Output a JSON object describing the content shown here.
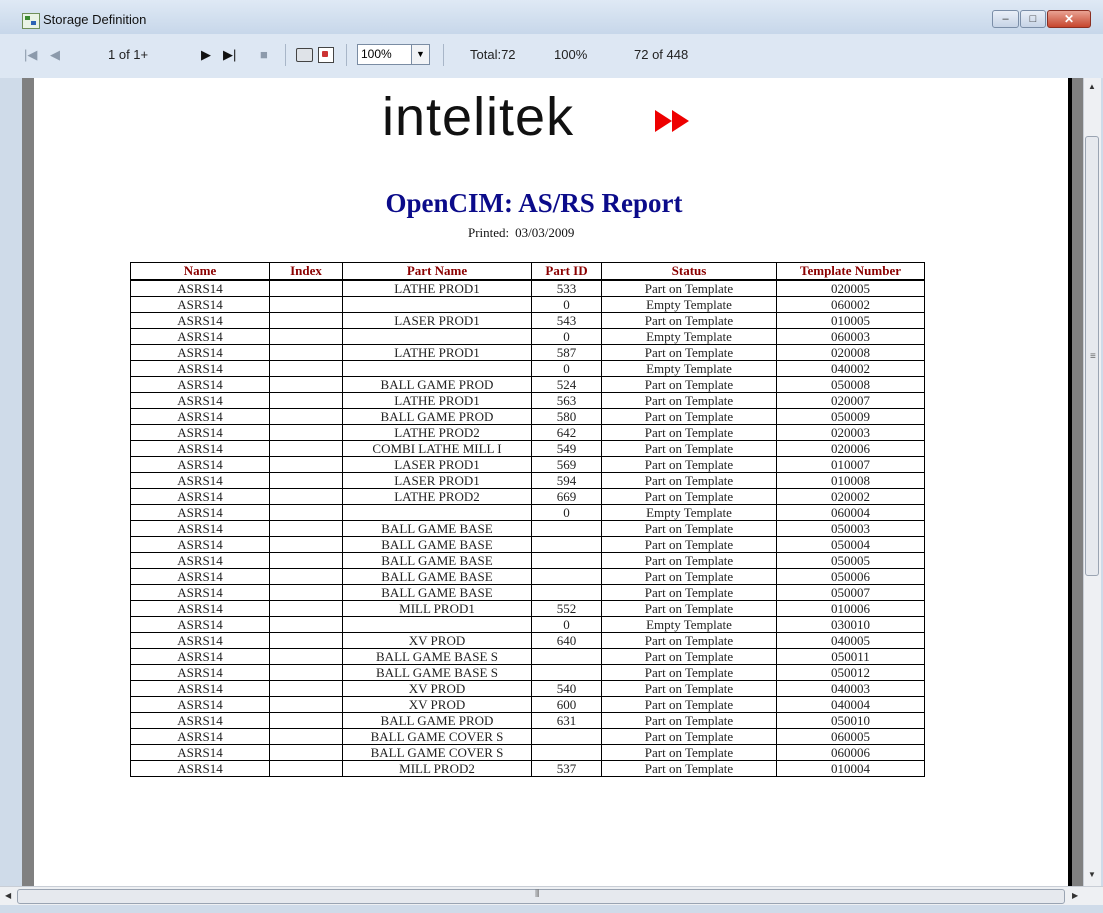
{
  "window": {
    "title": "Storage Definition",
    "min_glyph": "–",
    "max_glyph": "□",
    "close_glyph": "✕"
  },
  "toolbar": {
    "first_icon": "|◀",
    "prev_icon": "◀",
    "page_indicator": "1 of 1+",
    "next_icon": "▶",
    "last_icon": "▶|",
    "stop_icon": "■",
    "zoom_value": "100%",
    "total": "Total:72",
    "percent": "100%",
    "count": "72 of 448"
  },
  "report": {
    "logo_text": "intelitek",
    "title": "OpenCIM: AS/RS Report",
    "printed_label": "Printed:",
    "printed_date": "03/03/2009",
    "columns": [
      "Name",
      "Index",
      "Part Name",
      "Part ID",
      "Status",
      "Template Number"
    ],
    "rows": [
      [
        "ASRS14",
        "",
        "LATHE PROD1",
        "533",
        "Part on Template",
        "020005"
      ],
      [
        "ASRS14",
        "",
        "",
        "0",
        "Empty Template",
        "060002"
      ],
      [
        "ASRS14",
        "",
        "LASER PROD1",
        "543",
        "Part on Template",
        "010005"
      ],
      [
        "ASRS14",
        "",
        "",
        "0",
        "Empty Template",
        "060003"
      ],
      [
        "ASRS14",
        "",
        "LATHE PROD1",
        "587",
        "Part on Template",
        "020008"
      ],
      [
        "ASRS14",
        "",
        "",
        "0",
        "Empty Template",
        "040002"
      ],
      [
        "ASRS14",
        "",
        "BALL GAME PROD",
        "524",
        "Part on Template",
        "050008"
      ],
      [
        "ASRS14",
        "",
        "LATHE PROD1",
        "563",
        "Part on Template",
        "020007"
      ],
      [
        "ASRS14",
        "",
        "BALL GAME PROD",
        "580",
        "Part on Template",
        "050009"
      ],
      [
        "ASRS14",
        "",
        "LATHE PROD2",
        "642",
        "Part on Template",
        "020003"
      ],
      [
        "ASRS14",
        "",
        "COMBI LATHE MILL I",
        "549",
        "Part on Template",
        "020006"
      ],
      [
        "ASRS14",
        "",
        "LASER PROD1",
        "569",
        "Part on Template",
        "010007"
      ],
      [
        "ASRS14",
        "",
        "LASER PROD1",
        "594",
        "Part on Template",
        "010008"
      ],
      [
        "ASRS14",
        "",
        "LATHE PROD2",
        "669",
        "Part on Template",
        "020002"
      ],
      [
        "ASRS14",
        "",
        "",
        "0",
        "Empty Template",
        "060004"
      ],
      [
        "ASRS14",
        "",
        "BALL GAME BASE",
        "",
        "Part on Template",
        "050003"
      ],
      [
        "ASRS14",
        "",
        "BALL GAME BASE",
        "",
        "Part on Template",
        "050004"
      ],
      [
        "ASRS14",
        "",
        "BALL GAME BASE",
        "",
        "Part on Template",
        "050005"
      ],
      [
        "ASRS14",
        "",
        "BALL GAME BASE",
        "",
        "Part on Template",
        "050006"
      ],
      [
        "ASRS14",
        "",
        "BALL GAME BASE",
        "",
        "Part on Template",
        "050007"
      ],
      [
        "ASRS14",
        "",
        "MILL PROD1",
        "552",
        "Part on Template",
        "010006"
      ],
      [
        "ASRS14",
        "",
        "",
        "0",
        "Empty Template",
        "030010"
      ],
      [
        "ASRS14",
        "",
        "XV PROD",
        "640",
        "Part on Template",
        "040005"
      ],
      [
        "ASRS14",
        "",
        "BALL GAME BASE S",
        "",
        "Part on Template",
        "050011"
      ],
      [
        "ASRS14",
        "",
        "BALL GAME BASE S",
        "",
        "Part on Template",
        "050012"
      ],
      [
        "ASRS14",
        "",
        "XV PROD",
        "540",
        "Part on Template",
        "040003"
      ],
      [
        "ASRS14",
        "",
        "XV PROD",
        "600",
        "Part on Template",
        "040004"
      ],
      [
        "ASRS14",
        "",
        "BALL GAME PROD",
        "631",
        "Part on Template",
        "050010"
      ],
      [
        "ASRS14",
        "",
        "BALL GAME COVER S",
        "",
        "Part on Template",
        "060005"
      ],
      [
        "ASRS14",
        "",
        "BALL GAME COVER S",
        "",
        "Part on Template",
        "060006"
      ],
      [
        "ASRS14",
        "",
        "MILL PROD2",
        "537",
        "Part on Template",
        "010004"
      ]
    ]
  },
  "colors": {
    "title_blue": "#0b0b8a",
    "header_red": "#8b0000",
    "logo_arrow_red": "#ee0000"
  },
  "icons": {
    "print": "printer-icon",
    "export": "export-icon",
    "app": "storage-definition-app-icon"
  }
}
